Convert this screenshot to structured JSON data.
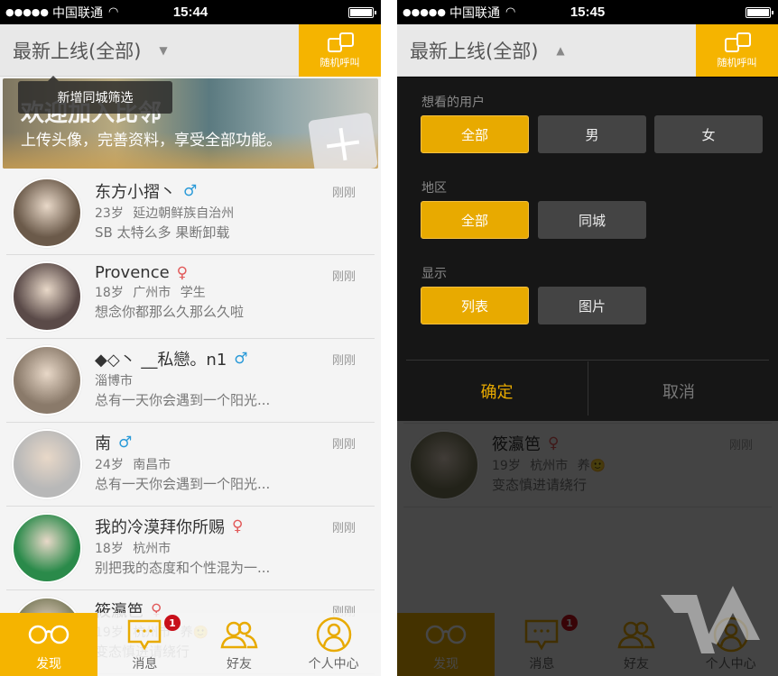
{
  "screens": [
    {
      "status": {
        "dots": "●●●●●",
        "carrier": "中国联通",
        "time": "15:44"
      },
      "header": {
        "title": "最新上线(全部)",
        "arrow": "▼",
        "random_call": "随机呼叫"
      },
      "tooltip": "新增同城筛选",
      "banner": {
        "title": "欢迎加入比邻",
        "subtitle": "上传头像，完善资料，享受全部功能。"
      }
    },
    {
      "status": {
        "dots": "●●●●●",
        "carrier": "中国联通",
        "time": "15:45"
      },
      "header": {
        "title": "最新上线(全部)",
        "arrow": "▲",
        "random_call": "随机呼叫"
      }
    }
  ],
  "users": [
    {
      "name": "东方小摺丶",
      "gender": "♂",
      "gender_type": "male",
      "meta": "23岁 延边朝鲜族自治州",
      "signature": "  SB 太特么多 果断卸载",
      "time": "刚刚",
      "avatar_color": "#6b5a4a"
    },
    {
      "name": "Provence",
      "gender": "♀",
      "gender_type": "female",
      "meta": "18岁 广州市 学生",
      "signature": "想念你都那么久那么久啦",
      "time": "刚刚",
      "avatar_color": "#5a4a48"
    },
    {
      "name": "◆◇丶 __私戀。n1",
      "gender": "♂",
      "gender_type": "male",
      "meta": "淄博市",
      "signature": "总有一天你会遇到一个阳光...",
      "time": "刚刚",
      "avatar_color": "#8a7a6a"
    },
    {
      "name": "南",
      "gender": "♂",
      "gender_type": "male",
      "meta": "24岁 南昌市",
      "signature": "总有一天你会遇到一个阳光...",
      "time": "刚刚",
      "avatar_color": "#b8b8b8"
    },
    {
      "name": "我的冷漠拜你所赐",
      "gender": "♀",
      "gender_type": "female",
      "meta": "18岁 杭州市",
      "signature": "别把我的态度和个性混为一...",
      "time": "刚刚",
      "avatar_color": "#2a8a4a"
    },
    {
      "name": "筱瀛笆",
      "gender": "♀",
      "gender_type": "female",
      "meta": "19岁 杭州市 养🙂",
      "signature": "变态慎进请绕行",
      "time": "刚刚",
      "avatar_color": "#7a7a5a"
    }
  ],
  "tabbar": {
    "tabs": [
      {
        "label": "发现",
        "icon": "glasses-icon",
        "active": true
      },
      {
        "label": "消息",
        "icon": "message-icon",
        "badge": "1"
      },
      {
        "label": "好友",
        "icon": "friends-icon"
      },
      {
        "label": "个人中心",
        "icon": "profile-icon"
      }
    ]
  },
  "filter_panel": {
    "sections": [
      {
        "label": "想看的用户",
        "options": [
          "全部",
          "男",
          "女"
        ],
        "selected": "全部"
      },
      {
        "label": "地区",
        "options": [
          "全部",
          "同城"
        ],
        "selected": "全部"
      },
      {
        "label": "显示",
        "options": [
          "列表",
          "图片"
        ],
        "selected": "列表"
      }
    ],
    "confirm": "确定",
    "cancel": "取消"
  },
  "colors": {
    "accent": "#f5b400",
    "male": "#2a9ad8",
    "female": "#e25a5a",
    "badge": "#c8101a"
  }
}
